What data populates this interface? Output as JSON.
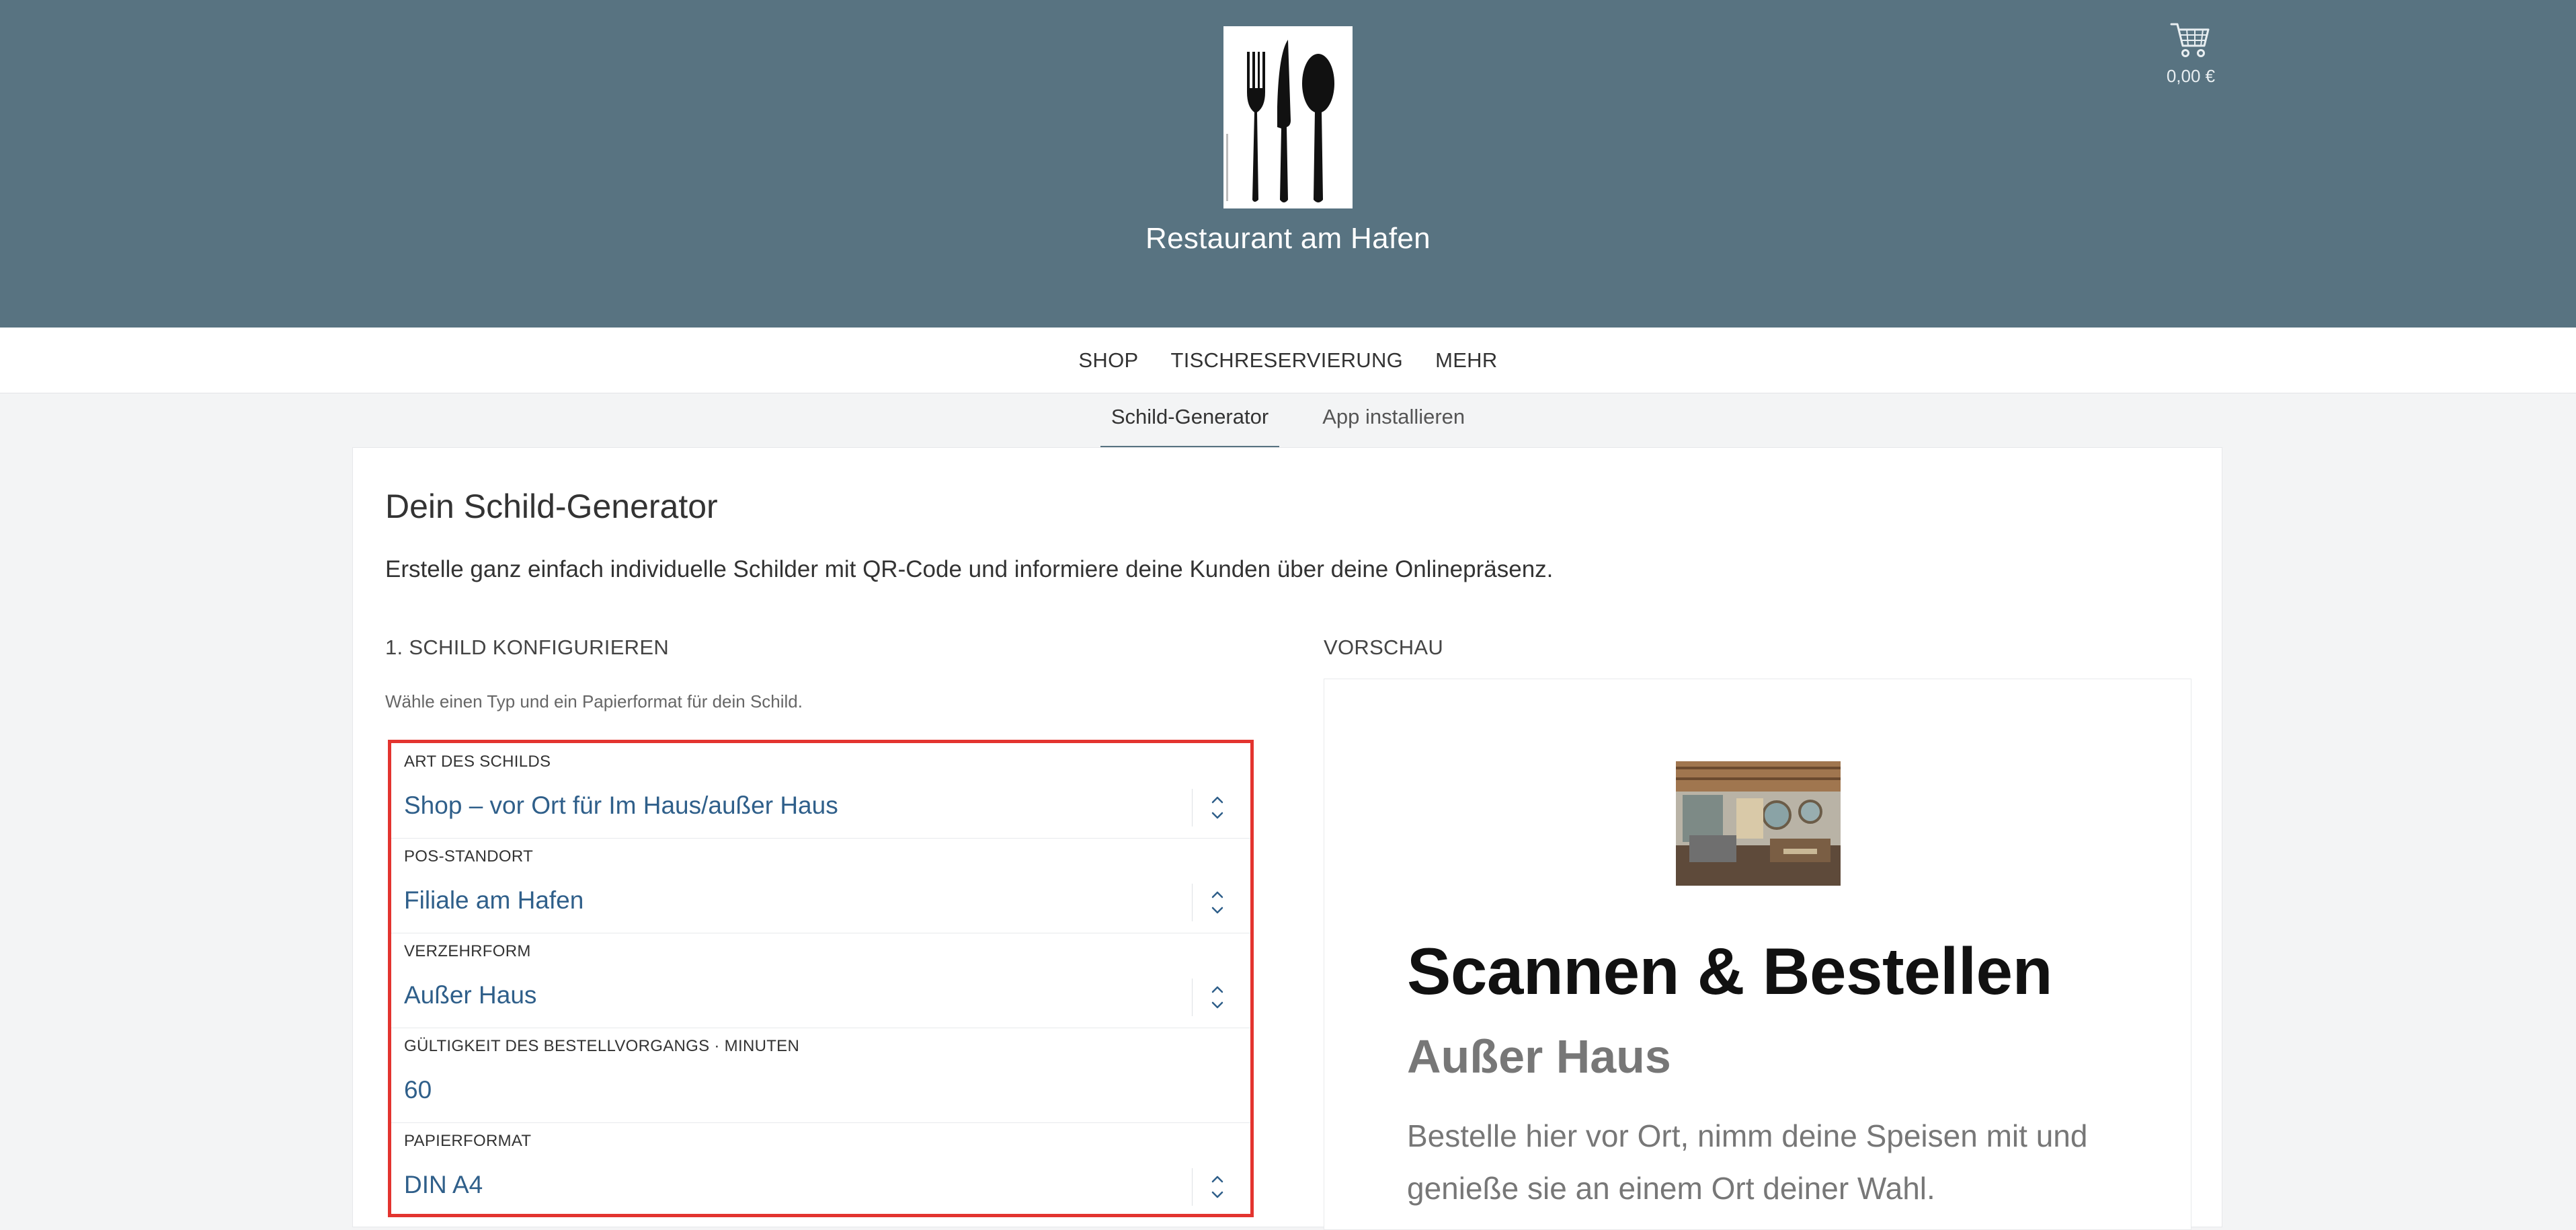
{
  "header": {
    "brand_name": "Restaurant am Hafen",
    "logo_icon": "cutlery-icon",
    "background_color": "#587381",
    "cart": {
      "icon": "shopping-cart-icon",
      "total": "0,00 €"
    }
  },
  "main_nav": {
    "items": [
      {
        "label": "SHOP"
      },
      {
        "label": "TISCHRESERVIERUNG"
      },
      {
        "label": "MEHR"
      }
    ]
  },
  "sub_nav": {
    "tabs": [
      {
        "label": "Schild-Generator",
        "active": true
      },
      {
        "label": "App installieren",
        "active": false
      }
    ]
  },
  "card": {
    "title": "Dein Schild-Generator",
    "intro": "Erstelle ganz einfach individuelle Schilder mit QR-Code und informiere deine Kunden über deine Onlinepräsenz."
  },
  "configure": {
    "section_label": "1. SCHILD KONFIGURIEREN",
    "hint": "Wähle einen Typ und ein Papierformat für dein Schild.",
    "highlight_color": "#e3342f",
    "fields": [
      {
        "label": "ART DES SCHILDS",
        "value": "Shop – vor Ort für Im Haus/außer Haus",
        "type": "select"
      },
      {
        "label": "POS-STANDORT",
        "value": "Filiale am Hafen",
        "type": "select"
      },
      {
        "label": "VERZEHRFORM",
        "value": "Außer Haus",
        "type": "select"
      },
      {
        "label": "GÜLTIGKEIT DES BESTELLVORGANGS · MINUTEN",
        "value": "60",
        "type": "number"
      },
      {
        "label": "PAPIERFORMAT",
        "value": "DIN A4",
        "type": "select"
      }
    ]
  },
  "preview": {
    "section_label": "VORSCHAU",
    "image": "restaurant-interior-photo",
    "heading": "Scannen & Bestellen",
    "subheading": "Außer Haus",
    "text": "Bestelle hier vor Ort, nimm deine Speisen mit und genieße sie an einem Ort deiner Wahl."
  }
}
